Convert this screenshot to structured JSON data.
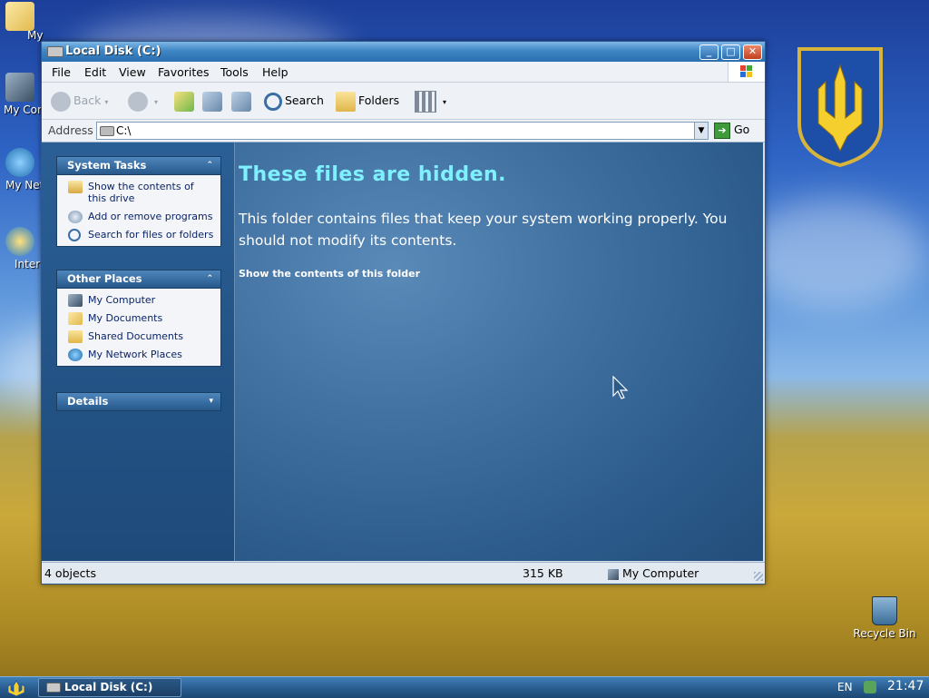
{
  "desktop": {
    "icons": [
      {
        "label": "My Documents",
        "icon": "my-documents-icon"
      },
      {
        "label": "My Computer",
        "icon": "my-computer-icon"
      },
      {
        "label": "My Network Places",
        "icon": "network-places-icon"
      },
      {
        "label": "Internet Explorer",
        "icon": "ie-icon"
      }
    ],
    "recycle_bin": "Recycle Bin"
  },
  "window": {
    "title": "Local Disk (C:)",
    "menu": [
      "File",
      "Edit",
      "View",
      "Favorites",
      "Tools",
      "Help"
    ],
    "toolbar": {
      "back": "Back",
      "search": "Search",
      "folders": "Folders"
    },
    "address": {
      "label": "Address",
      "value": "C:\\",
      "go": "Go"
    },
    "left_pane": {
      "system_tasks": {
        "title": "System Tasks",
        "items": [
          {
            "label": "Show the contents of this drive",
            "icon": "show-contents-icon"
          },
          {
            "label": "Add or remove programs",
            "icon": "add-remove-icon"
          },
          {
            "label": "Search for files or folders",
            "icon": "search-icon"
          }
        ]
      },
      "other_places": {
        "title": "Other Places",
        "items": [
          {
            "label": "My Computer",
            "icon": "my-computer-icon"
          },
          {
            "label": "My Documents",
            "icon": "my-documents-icon"
          },
          {
            "label": "Shared Documents",
            "icon": "folder-icon"
          },
          {
            "label": "My Network Places",
            "icon": "network-places-icon"
          }
        ]
      },
      "details": {
        "title": "Details"
      }
    },
    "content": {
      "heading": "These files are hidden.",
      "description": "This folder contains files that keep your system working properly. You should not modify its contents.",
      "show_link": "Show the contents of this folder"
    },
    "status": {
      "objects": "4 objects",
      "size": "315 KB",
      "location": "My Computer"
    }
  },
  "taskbar": {
    "task": "Local Disk (C:)",
    "language": "EN",
    "clock": "21:47"
  },
  "colors": {
    "heading": "#7ff0ff",
    "link": "#0a246a",
    "title_bar": "#3e86c4"
  }
}
